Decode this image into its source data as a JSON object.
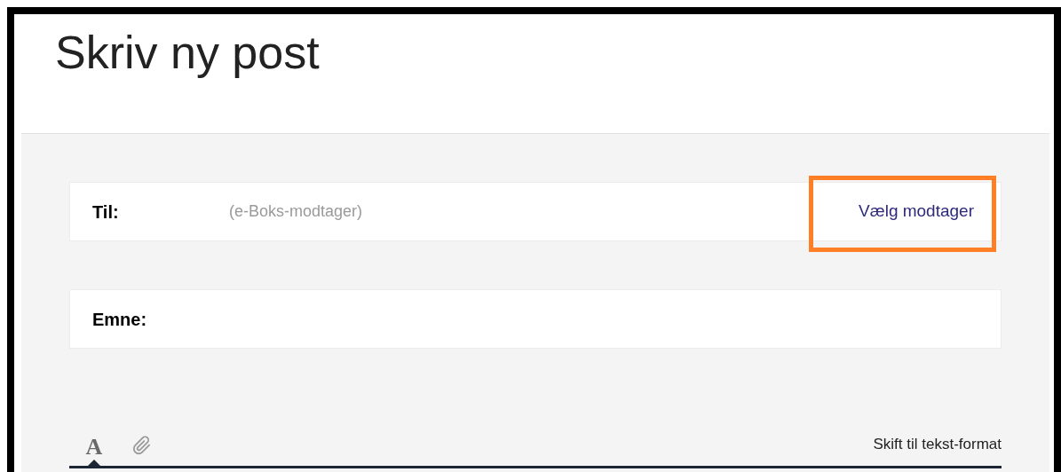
{
  "page": {
    "title": "Skriv ny post"
  },
  "fields": [
    {
      "label": "Til:",
      "placeholder": "(e-Boks-modtager)",
      "action": {
        "label": "Vælg modtager",
        "highlighted": true
      }
    },
    {
      "label": "Emne:"
    }
  ],
  "editor_toolbar": {
    "tabs": [
      {
        "kind": "format",
        "label": "A",
        "selected": true
      },
      {
        "kind": "attach",
        "selected": false
      }
    ],
    "switch_link": "Skift til tekst-format"
  }
}
